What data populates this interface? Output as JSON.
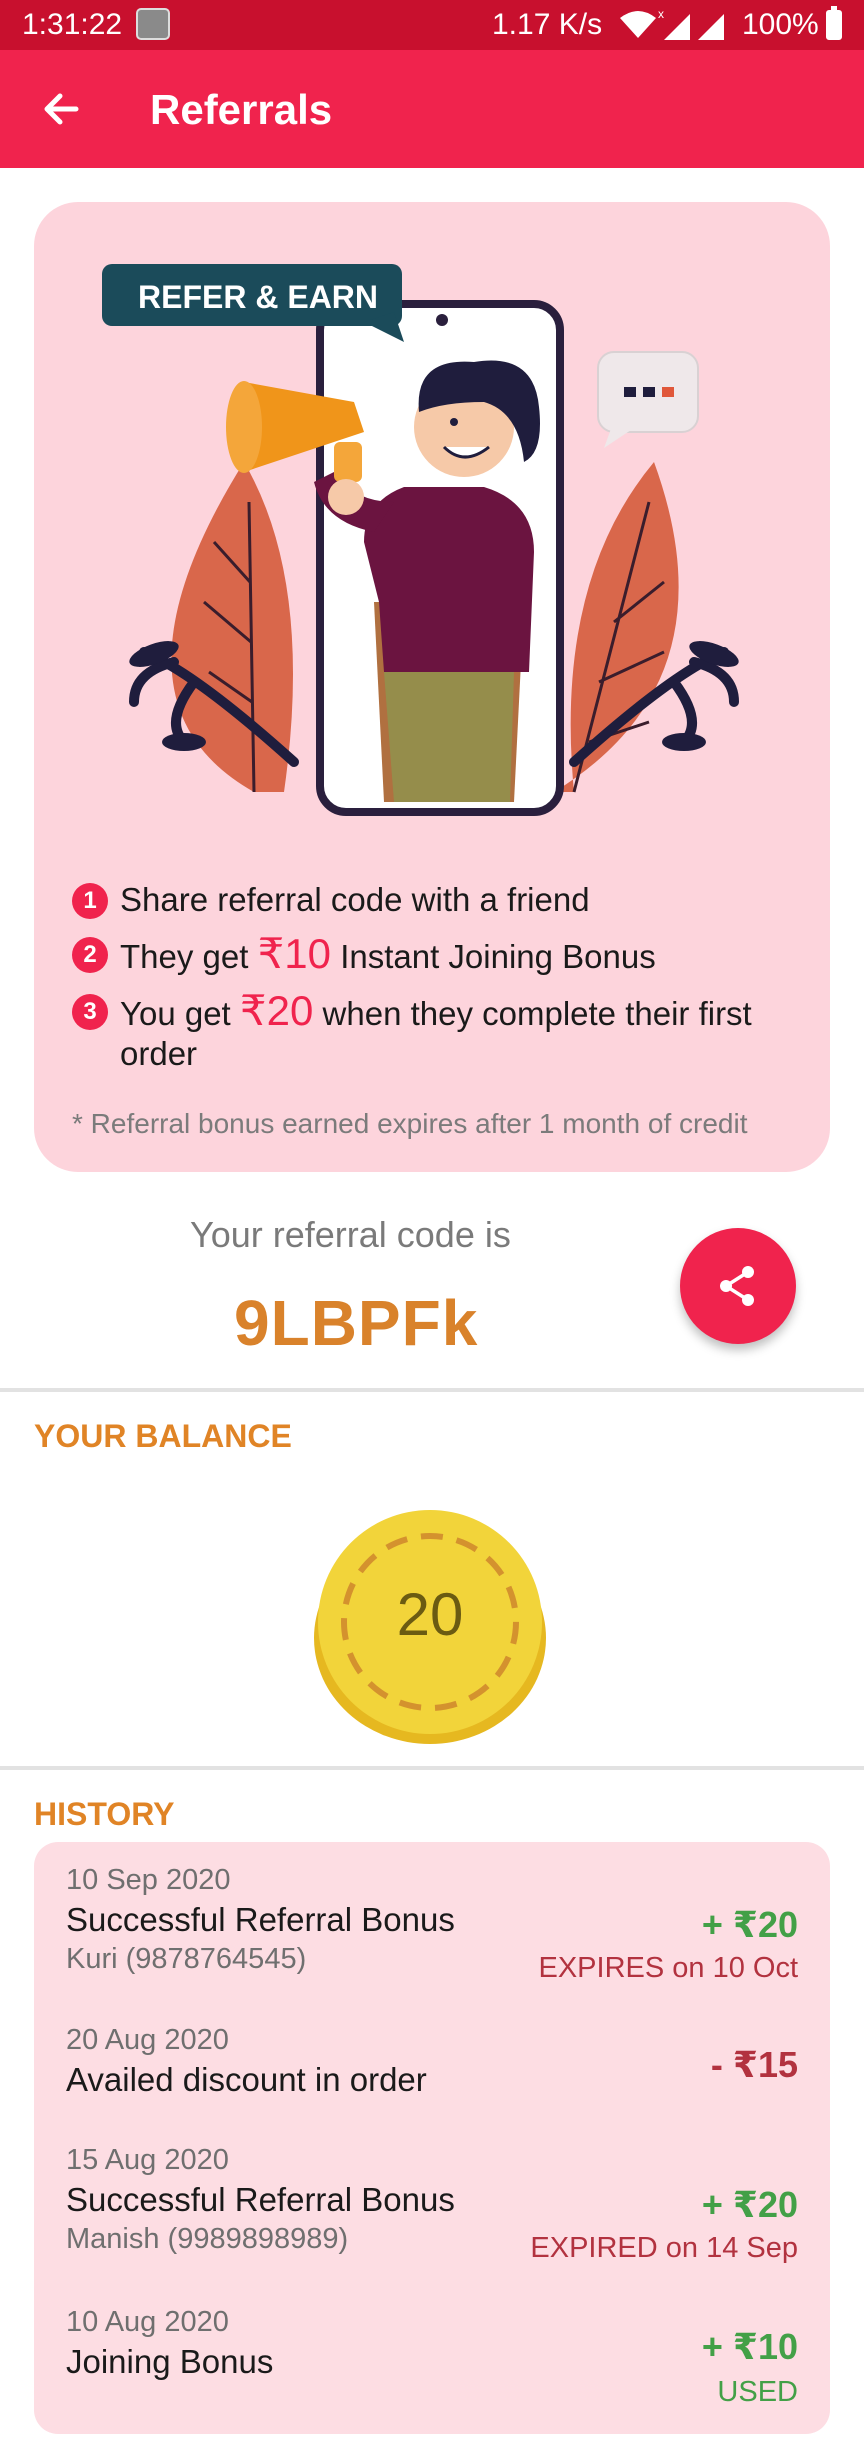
{
  "status_bar": {
    "time": "1:31:22",
    "network_speed": "1.17 K/s",
    "battery": "100%",
    "icons": [
      "gallery-thumbnail-icon",
      "wifi-icon",
      "signal-icon",
      "signal-icon",
      "battery-icon"
    ]
  },
  "app_bar": {
    "title": "Referrals",
    "back_icon": "arrow-left-icon"
  },
  "promo": {
    "badge": "REFER & EARN",
    "steps": [
      {
        "num": "1",
        "text": "Share referral code with a friend"
      },
      {
        "num": "2",
        "before": "They get ",
        "amount": "₹10",
        "after": " Instant Joining Bonus"
      },
      {
        "num": "3",
        "before": "You get ",
        "amount": "₹20",
        "after": " when they complete their first order"
      }
    ],
    "note": "* Referral bonus earned expires after 1 month of credit"
  },
  "referral": {
    "label": "Your referral code is",
    "code": "9LBPFk",
    "share_icon": "share-icon"
  },
  "balance": {
    "heading": "YOUR BALANCE",
    "value": "20"
  },
  "history": {
    "heading": "HISTORY",
    "items": [
      {
        "date": "10 Sep 2020",
        "description": "Successful Referral Bonus",
        "sub": "Kuri (9878764545)",
        "amount": "+ ₹20",
        "status": "EXPIRES on 10 Oct"
      },
      {
        "date": "20 Aug 2020",
        "description": "Availed discount in order",
        "sub": "",
        "amount": "- ₹15",
        "status": ""
      },
      {
        "date": "15 Aug 2020",
        "description": "Successful Referral Bonus",
        "sub": "Manish (9989898989)",
        "amount": "+ ₹20",
        "status": "EXPIRED on 14 Sep"
      },
      {
        "date": "10 Aug 2020",
        "description": "Joining Bonus",
        "sub": "",
        "amount": "+ ₹10",
        "status": "USED"
      }
    ]
  },
  "colors": {
    "status_bar": "#c8102e",
    "app_bar": "#f0234d",
    "promo_card": "#fdd4dc",
    "accent_orange": "#e08426",
    "credit_green": "#43a047",
    "debit_red": "#b2323f",
    "coin": "#f2d43a"
  }
}
